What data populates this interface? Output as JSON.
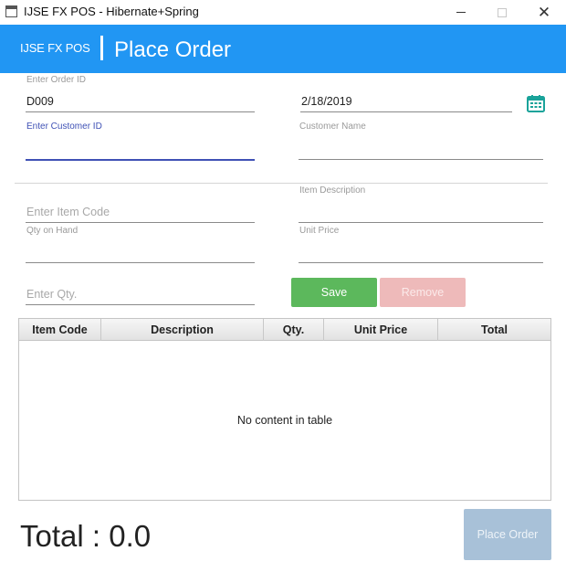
{
  "window": {
    "title": "IJSE FX POS - Hibernate+Spring"
  },
  "header": {
    "brand": "IJSE FX POS",
    "page_title": "Place Order"
  },
  "order": {
    "order_id_label": "Enter Order ID",
    "order_id_value": "D009",
    "date_value": "2/18/2019",
    "customer_id_label": "Enter Customer ID",
    "customer_name_label": "Customer Name"
  },
  "item": {
    "item_code_placeholder": "Enter Item Code",
    "item_description_label": "Item Description",
    "qty_on_hand_label": "Qty on Hand",
    "unit_price_label": "Unit Price",
    "qty_placeholder": "Enter Qty."
  },
  "buttons": {
    "save": "Save",
    "remove": "Remove",
    "place_order": "Place Order"
  },
  "table": {
    "columns": [
      "Item Code",
      "Description",
      "Qty.",
      "Unit Price",
      "Total"
    ],
    "empty_text": "No content in table"
  },
  "total_text": "Total : 0.0",
  "colors": {
    "header": "#2196f3",
    "save": "#5cb85c",
    "remove": "#eebaba",
    "place_order": "#a8c1d8",
    "focus": "#3f51b5",
    "calendar": "#1aa39a"
  },
  "icons": {
    "calendar": "calendar-icon"
  }
}
